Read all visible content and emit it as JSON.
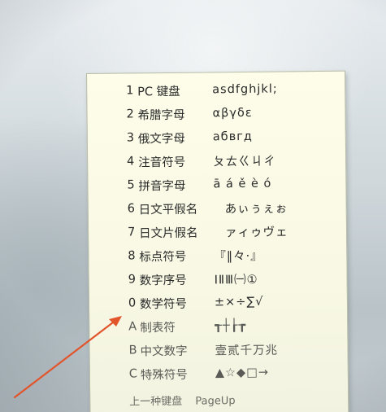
{
  "menu": {
    "items": [
      {
        "num": "1",
        "label": "PC 键盘",
        "sample": "asdfghjkl;"
      },
      {
        "num": "2",
        "label": "希腊字母",
        "sample": "αβγδε"
      },
      {
        "num": "3",
        "label": "俄文字母",
        "sample": "абвгд"
      },
      {
        "num": "4",
        "label": "注音符号",
        "sample": "ㄆㄊㄍㄐㄔ"
      },
      {
        "num": "5",
        "label": "拼音字母",
        "sample": "ā á ě è ó"
      },
      {
        "num": "6",
        "label": "日文平假名",
        "sample": "あぃぅぇぉ"
      },
      {
        "num": "7",
        "label": "日文片假名",
        "sample": "ァィゥヴェ"
      },
      {
        "num": "8",
        "label": "标点符号",
        "sample": "『‖々·』"
      },
      {
        "num": "9",
        "label": "数字序号",
        "sample": "ⅠⅡⅢ㈠①"
      },
      {
        "num": "0",
        "label": "数学符号",
        "sample": "±×÷∑√"
      },
      {
        "num": "A",
        "label": "制表符",
        "sample": "┱┼┟┲"
      },
      {
        "num": "B",
        "label": "中文数字",
        "sample": "壹贰千万兆"
      },
      {
        "num": "C",
        "label": "特殊符号",
        "sample": "▲☆◆□→"
      }
    ],
    "footer": {
      "label": "上一种键盘",
      "sample": "PageUp"
    }
  },
  "colors": {
    "menu_bg": "#f8f8e4",
    "arrow": "#e2542a",
    "text": "#2a2a2a"
  }
}
